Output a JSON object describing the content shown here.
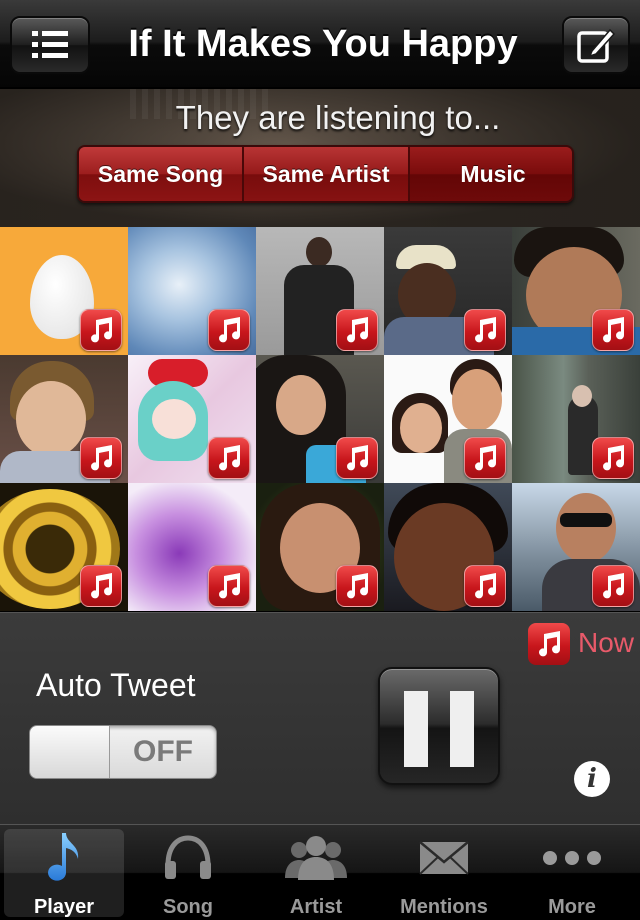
{
  "header": {
    "title": "If It Makes You Happy",
    "left_icon": "list-icon",
    "right_icon": "compose-icon"
  },
  "banner": {
    "text": "They are listening to...",
    "segments": [
      {
        "label": "Same Song"
      },
      {
        "label": "Same Artist"
      },
      {
        "label": "Music"
      }
    ]
  },
  "grid": {
    "badge_icon": "music-note-icon",
    "tiles": [
      {
        "name": "avatar-default-egg"
      },
      {
        "name": "avatar-sky"
      },
      {
        "name": "avatar-man-standing"
      },
      {
        "name": "avatar-man-cap"
      },
      {
        "name": "avatar-young-man"
      },
      {
        "name": "avatar-teen-boy"
      },
      {
        "name": "avatar-anime"
      },
      {
        "name": "avatar-woman-dark-hair"
      },
      {
        "name": "avatar-couple"
      },
      {
        "name": "avatar-forest"
      },
      {
        "name": "avatar-gold-badge"
      },
      {
        "name": "avatar-purple-figure"
      },
      {
        "name": "avatar-woman-smiling"
      },
      {
        "name": "avatar-woman-closeup"
      },
      {
        "name": "avatar-man-sunglasses"
      }
    ]
  },
  "player": {
    "now_label": "Now",
    "auto_tweet_label": "Auto Tweet",
    "toggle_state": "OFF",
    "info_label": "i"
  },
  "tabbar": {
    "tabs": [
      {
        "label": "Player",
        "icon": "music-note-icon",
        "active": true
      },
      {
        "label": "Song",
        "icon": "headphones-icon"
      },
      {
        "label": "Artist",
        "icon": "people-icon"
      },
      {
        "label": "Mentions",
        "icon": "envelope-icon"
      },
      {
        "label": "More",
        "icon": "more-dots-icon"
      }
    ]
  },
  "colors": {
    "accent_red": "#c8161c",
    "active_tab_icon": "#3a8ee6",
    "now_label": "#e85a6a"
  }
}
